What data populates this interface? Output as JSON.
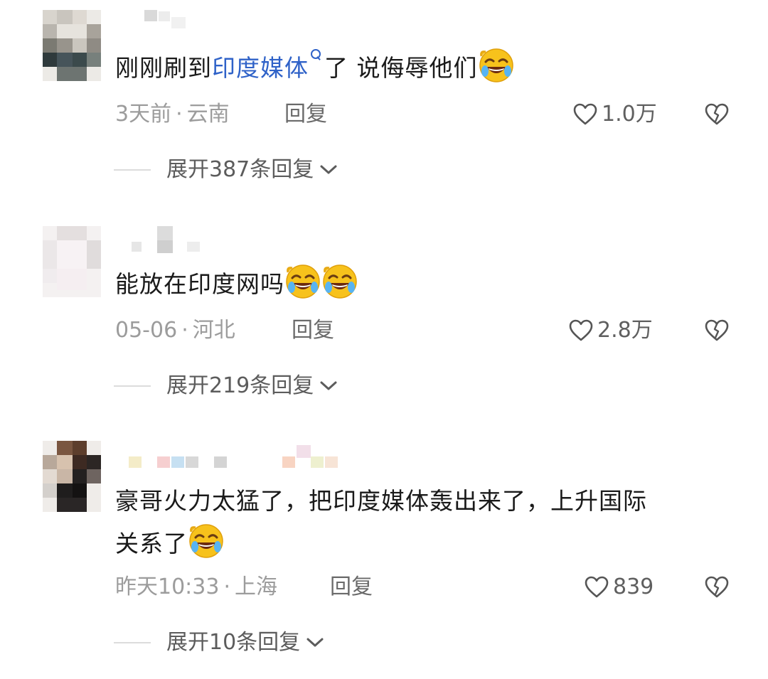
{
  "icons": {
    "like": "heart-outline-icon",
    "dislike": "broken-heart-icon",
    "expand": "chevron-down-icon",
    "search": "search-icon",
    "emoji": "rolling-on-floor-laughing-emoji"
  },
  "colors": {
    "link": "#2f62c8",
    "meta": "#9c9c9c",
    "text": "#1a1a1a"
  },
  "comments": [
    {
      "text_before": "刚刚刷到",
      "link_text": "印度媒体",
      "text_after": "了 说侮辱他们",
      "time": "3天前",
      "location": "云南",
      "reply_label": "回复",
      "likes": "1.0万",
      "expand_label": "展开387条回复"
    },
    {
      "text": "能放在印度网吗",
      "time": "05-06",
      "location": "河北",
      "reply_label": "回复",
      "likes": "2.8万",
      "expand_label": "展开219条回复"
    },
    {
      "text_line1": "豪哥火力太猛了，把印度媒体轰出来了，上升国际",
      "text_line2": "关系了",
      "time": "昨天10:33",
      "location": "上海",
      "reply_label": "回复",
      "likes": "839",
      "expand_label": "展开10条回复"
    }
  ]
}
